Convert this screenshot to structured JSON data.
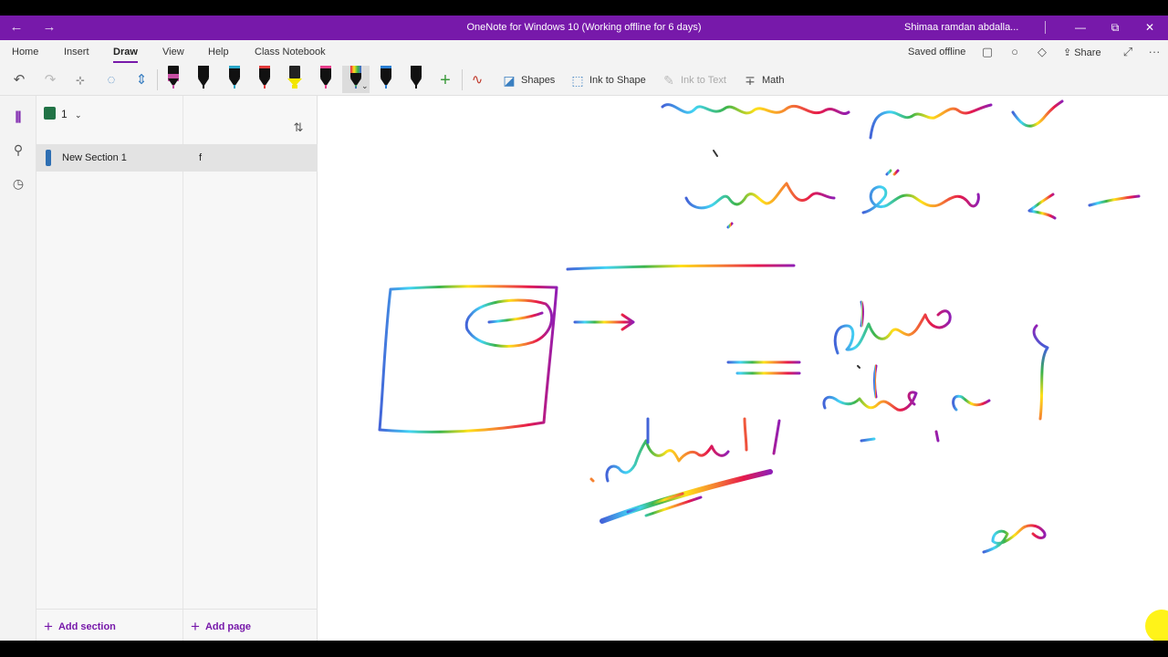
{
  "window": {
    "title": "OneNote for Windows 10 (Working offline for 6 days)",
    "user": "Shimaa ramdan abdalla...",
    "back_glyph": "←",
    "forward_glyph": "→",
    "minimize_glyph": "—",
    "restore_glyph": "⧉",
    "close_glyph": "✕",
    "accent": "#7719aa"
  },
  "ribbon": {
    "tabs": [
      "Home",
      "Insert",
      "Draw",
      "View",
      "Help",
      "Class Notebook"
    ],
    "active_tab": "Draw",
    "status": "Saved offline",
    "share_label": "Share",
    "more_glyph": "···",
    "icons": [
      "notebook-icon",
      "lightbulb-icon",
      "bell-icon",
      "share-icon",
      "expand-icon",
      "more-icon"
    ]
  },
  "toolbar": {
    "shapes_label": "Shapes",
    "ink_to_shape_label": "Ink to Shape",
    "ink_to_text_label": "Ink to Text",
    "math_label": "Math",
    "pens": [
      {
        "color": "#c64fa3",
        "kind": "marker"
      },
      {
        "color": "#111111",
        "kind": "pen"
      },
      {
        "color": "#2aa7c9",
        "kind": "pen"
      },
      {
        "color": "#e23b3b",
        "kind": "pen"
      },
      {
        "color": "#f3e600",
        "kind": "highlighter"
      },
      {
        "color": "#e83e8c",
        "kind": "pen"
      },
      {
        "color": "#8e44ad",
        "kind": "rainbow",
        "selected": true
      },
      {
        "color": "#2a7fd4",
        "kind": "pen"
      },
      {
        "color": "#111111",
        "kind": "pen"
      }
    ]
  },
  "navigation": {
    "notebook_name": "1",
    "sections": [
      {
        "name": "New Section 1",
        "color": "#2e6fb3",
        "selected": true
      }
    ],
    "pages": [
      {
        "title": "f",
        "selected": true
      }
    ],
    "add_section_label": "Add section",
    "add_page_label": "Add page"
  },
  "canvas": {
    "ink_colors": [
      "#e6194b",
      "#f58231",
      "#ffe119",
      "#3cb44b",
      "#42d4f4",
      "#4363d8",
      "#911eb4"
    ]
  }
}
